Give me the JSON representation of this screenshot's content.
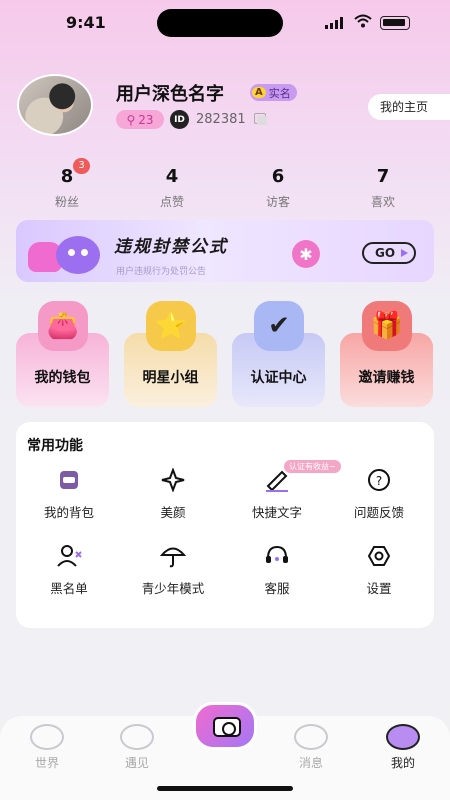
{
  "status_bar": {
    "time": "9:41"
  },
  "profile": {
    "username": "用户深色名字",
    "realname_badge": "实名",
    "realname_badge_prefix": "A",
    "level": "23",
    "id_label": "ID",
    "user_id": "282381",
    "homepage_button": "我的主页"
  },
  "stats": [
    {
      "value": "8",
      "label": "粉丝",
      "badge": "3"
    },
    {
      "value": "4",
      "label": "点赞"
    },
    {
      "value": "6",
      "label": "访客"
    },
    {
      "value": "7",
      "label": "喜欢"
    }
  ],
  "banner": {
    "title": "违规封禁公式",
    "subtitle": "用户违规行为处罚公告",
    "go_label": "GO"
  },
  "cards": [
    {
      "label": "我的钱包",
      "icon": "wallet-icon",
      "color": "#f7b3d8"
    },
    {
      "label": "明星小组",
      "icon": "star-icon",
      "color": "#f5dcaa"
    },
    {
      "label": "认证中心",
      "icon": "verify-icon",
      "color": "#c7c9f5"
    },
    {
      "label": "邀请赚钱",
      "icon": "gift-icon",
      "color": "#f7a6a4"
    }
  ],
  "common": {
    "title": "常用功能",
    "items": [
      {
        "label": "我的背包",
        "icon": "backpack-icon"
      },
      {
        "label": "美颜",
        "icon": "sparkle-icon"
      },
      {
        "label": "快捷文字",
        "icon": "pen-icon",
        "tip": "认证有收益~"
      },
      {
        "label": "问题反馈",
        "icon": "question-icon"
      },
      {
        "label": "黑名单",
        "icon": "blacklist-icon"
      },
      {
        "label": "青少年模式",
        "icon": "umbrella-icon"
      },
      {
        "label": "客服",
        "icon": "headset-icon"
      },
      {
        "label": "设置",
        "icon": "settings-icon"
      }
    ]
  },
  "tabs": [
    {
      "label": "世界",
      "icon": "planet-icon"
    },
    {
      "label": "遇见",
      "icon": "meet-icon"
    },
    {
      "label": "消息",
      "icon": "message-icon"
    },
    {
      "label": "我的",
      "icon": "me-icon",
      "active": true
    }
  ]
}
